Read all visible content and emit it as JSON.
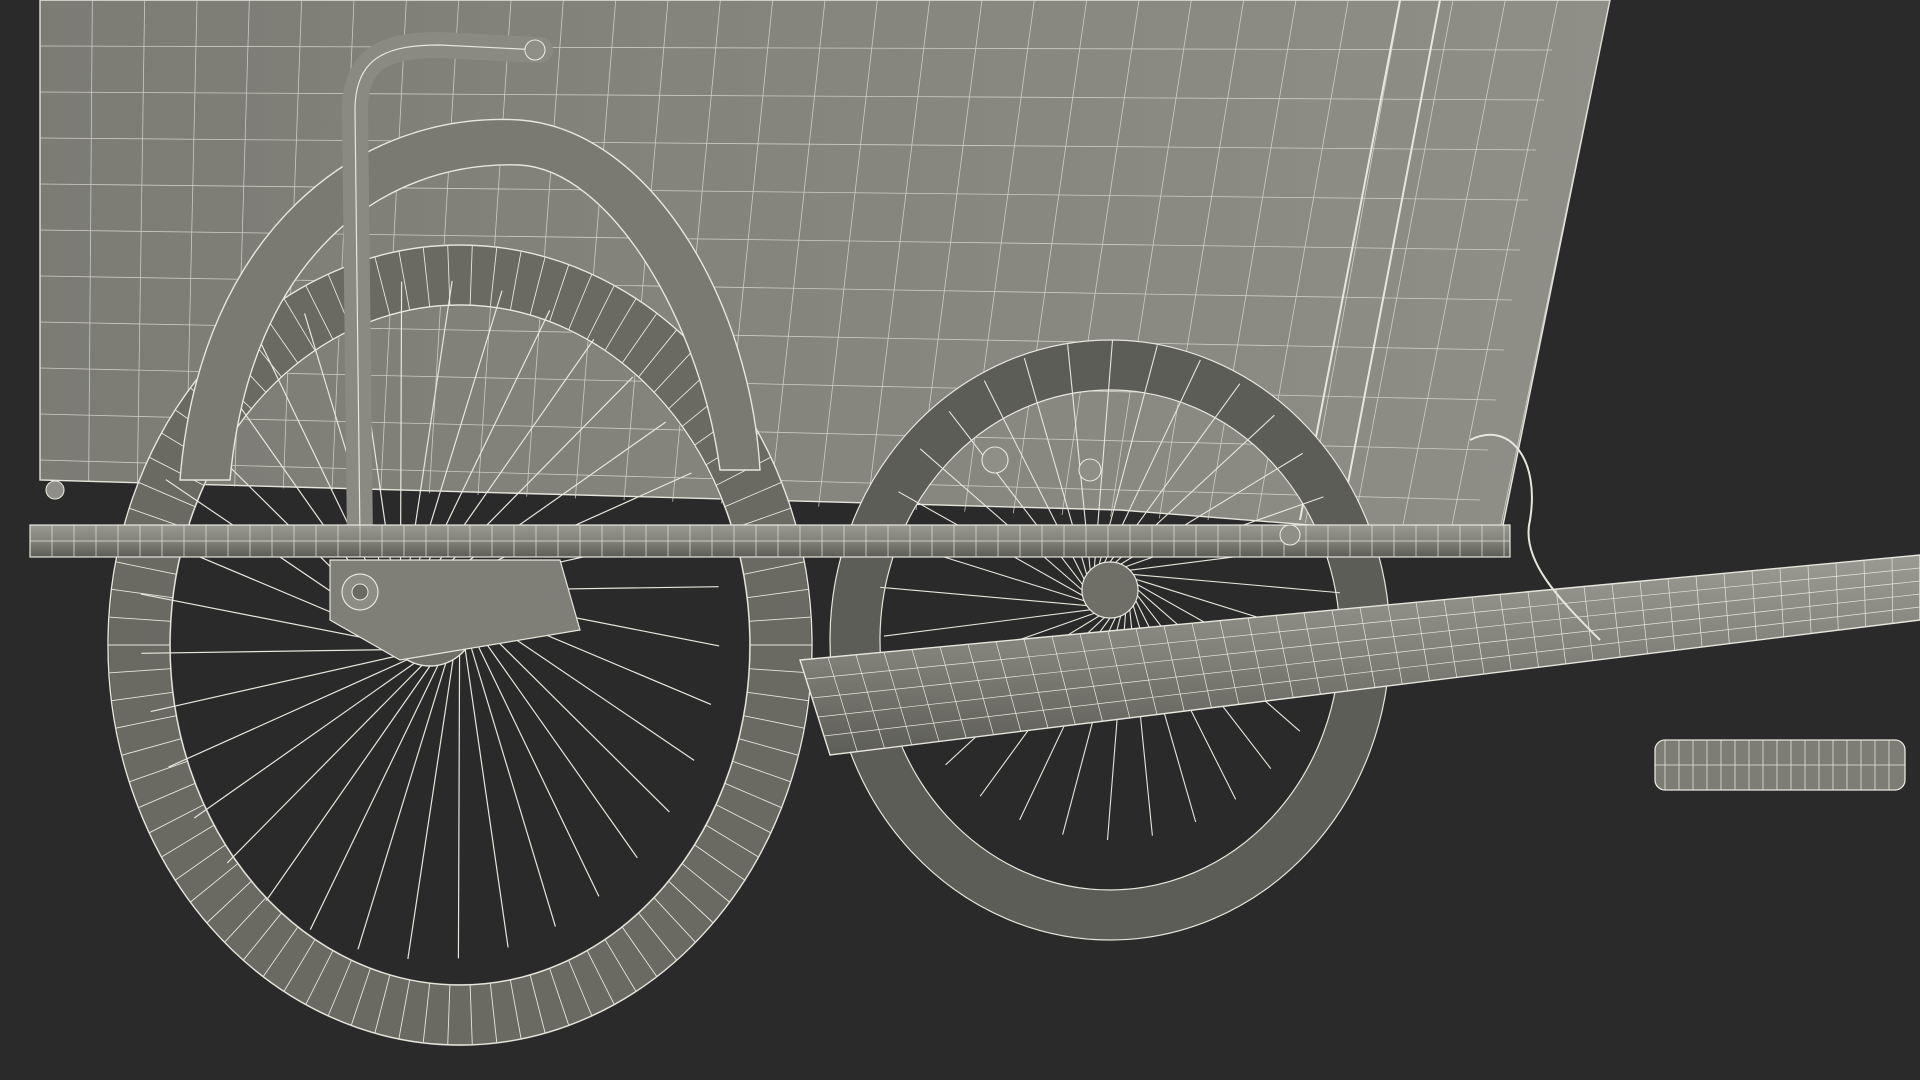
{
  "scene": {
    "subject": "cargo-tricycle-wireframe-render",
    "colors": {
      "background": "#2a2a2a",
      "shade_light": "#8a8a82",
      "shade_mid": "#6f6f68",
      "shade_dark": "#4f4f4a",
      "wire": "#e6e6dc",
      "wire_dim": "#b9b9b0"
    }
  }
}
